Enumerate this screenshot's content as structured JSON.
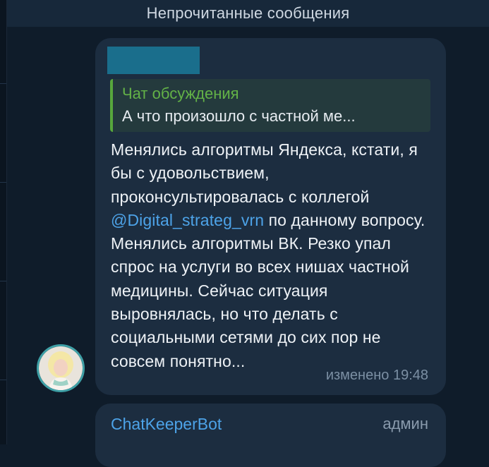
{
  "divider": {
    "label": "Непрочитанные сообщения"
  },
  "message": {
    "reply": {
      "title": "Чат обсуждения",
      "text": "А что произошло с частной ме..."
    },
    "text_before_mention": "Менялись алгоритмы Яндекса, кстати, я бы с удовольствием, проконсультировалась с коллегой ",
    "mention": "@Digital_strateg_vrn",
    "text_after_mention": " по данному вопросу. Менялись алгоритмы ВК. Резко упал спрос на услуги во всех нишах частной медицины. Сейчас ситуация выровнялась, но что делать с социальными сетями до сих пор не совсем понятно...",
    "meta": "изменено 19:48"
  },
  "next_message": {
    "sender": "ChatKeeperBot",
    "role": "админ"
  },
  "colors": {
    "background": "#0f1c2a",
    "bubble": "#1c2d40",
    "accent_link": "#4da3e8",
    "reply_accent": "#57a83c",
    "redacted_block": "#1a6e8c"
  }
}
